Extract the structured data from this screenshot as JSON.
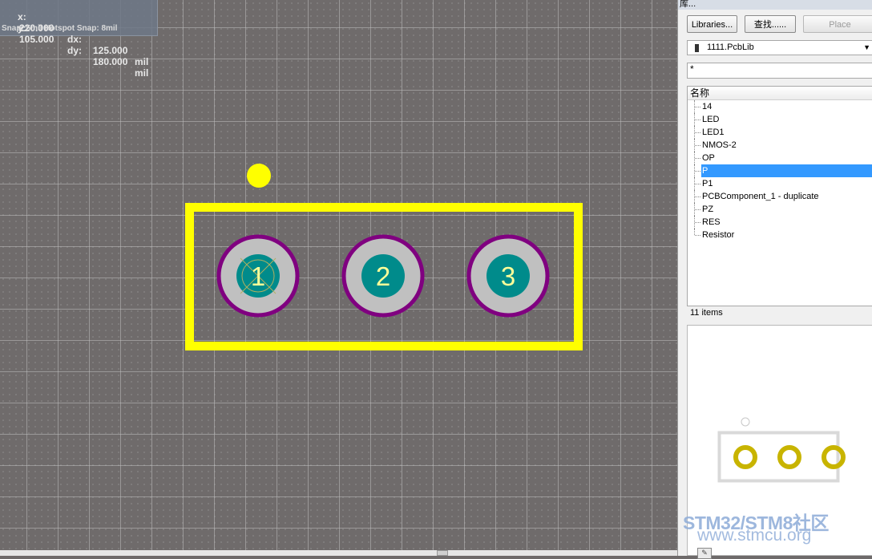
{
  "hud": {
    "x_label": "x:",
    "x_value": "220.000",
    "dx_label": "dx:",
    "dx_value": "125.000",
    "unit1": "mil",
    "y_label": "y:",
    "y_value": "105.000",
    "dy_label": "dy:",
    "dy_value": "180.000",
    "unit2": "mil",
    "snap": "Snap: 5mil Hotspot Snap: 8mil"
  },
  "pads": [
    {
      "label": "1"
    },
    {
      "label": "2"
    },
    {
      "label": "3"
    }
  ],
  "colors": {
    "canvas_bg": "#6f6b6b",
    "silkscreen": "#ffff00",
    "pad_ring": "#800080",
    "pad_copper": "#c0c0c0",
    "pad_hole": "#008b8b",
    "pad_text": "#ffff99",
    "selection": "#3399ff",
    "preview_pad": "#c8b400"
  },
  "panel": {
    "title": "库...",
    "libraries_button": "Libraries...",
    "search_button": "查找......",
    "place_button": "Place",
    "library_name": "1111.PcbLib",
    "filter_value": "*",
    "list_header": "名称",
    "items": [
      "14",
      "LED",
      "LED1",
      "NMOS-2",
      "OP",
      "P",
      "P1",
      "PCBComponent_1 - duplicate",
      "PZ",
      "RES",
      "Resistor"
    ],
    "selected_item": "P",
    "item_count": "11 items"
  },
  "watermark": {
    "line1": "STM32/STM8社区",
    "line2": "www.stmcu.org"
  }
}
